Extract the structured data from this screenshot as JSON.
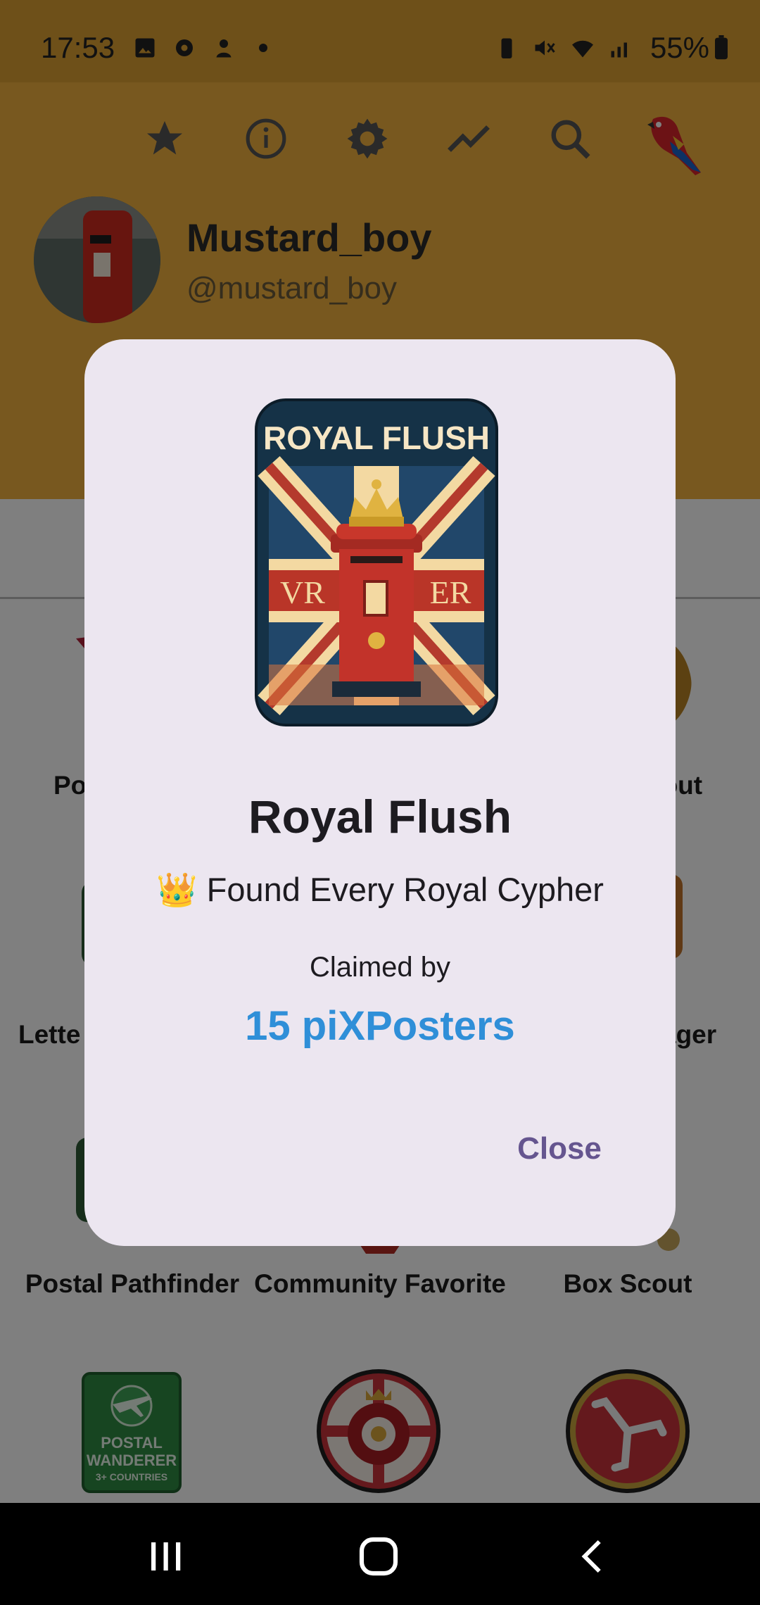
{
  "status_bar": {
    "time": "17:53",
    "battery_percent": "55%",
    "left_icons": [
      "gallery-icon",
      "settings-icon",
      "notification-icon",
      "dot-icon"
    ],
    "right_icons": [
      "battery-saver-icon",
      "mute-icon",
      "wifi-icon",
      "signal-icon"
    ]
  },
  "toolbar": {
    "icons": [
      "star-icon",
      "info-icon",
      "gear-icon",
      "trend-icon",
      "search-icon",
      "parrot-icon"
    ]
  },
  "profile": {
    "name": "Mustard_boy",
    "handle": "@mustard_boy"
  },
  "badges": {
    "row1": [
      "Po",
      "cout"
    ],
    "row2": [
      "Lette",
      "ager"
    ],
    "row3": [
      "Postal Pathfinder",
      "Community Favorite",
      "Box Scout"
    ],
    "row4_icons": [
      "postal-wanderer-badge",
      "tudor-rose-badge",
      "isle-of-man-badge"
    ],
    "postal_wanderer": {
      "line1": "POSTAL",
      "line2": "WANDERER",
      "line3": "3+ COUNTRIES"
    }
  },
  "dialog": {
    "image_caption": "ROYAL FLUSH",
    "image_left_cypher": "VR",
    "image_right_cypher": "ER",
    "title": "Royal Flush",
    "subtitle_emoji": "👑",
    "subtitle": "Found Every Royal Cypher",
    "claimed_label": "Claimed by",
    "claimed_count": "15 piXPosters",
    "close_label": "Close"
  },
  "colors": {
    "header": "#f0b13f",
    "dialog_bg": "#ece6f0",
    "accent_blue": "#2f8fd8",
    "button_purple": "#65558f"
  }
}
